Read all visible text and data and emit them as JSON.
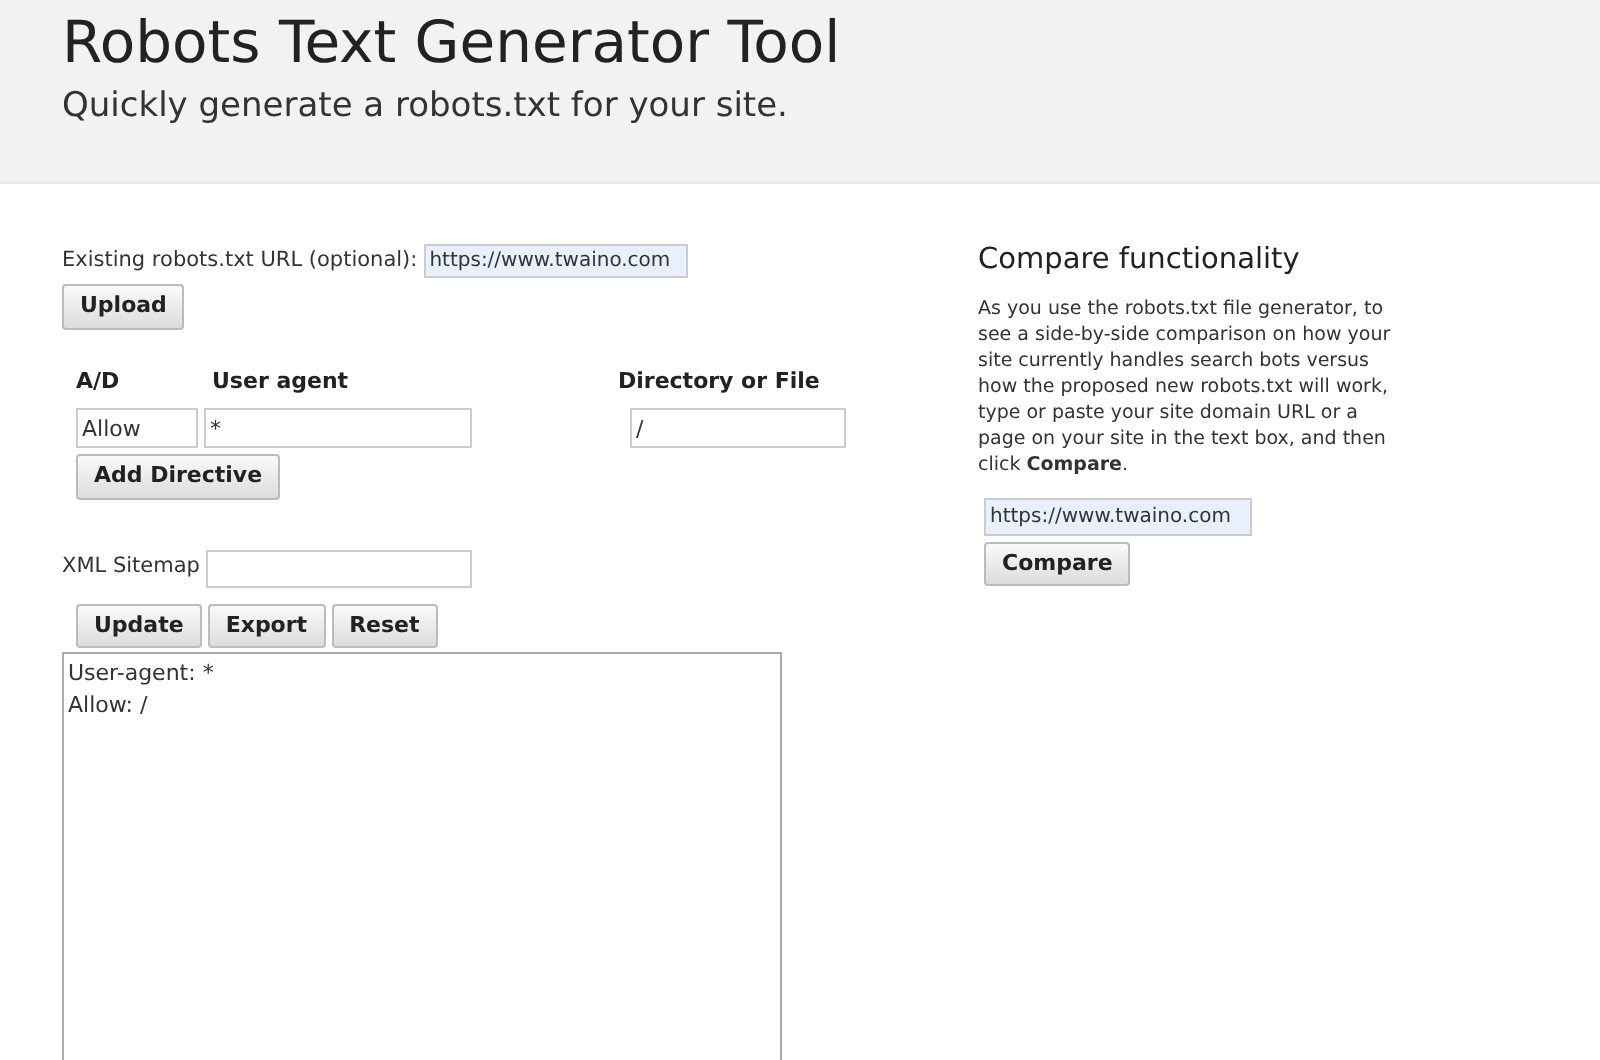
{
  "header": {
    "title": "Robots Text Generator Tool",
    "subtitle": "Quickly generate a robots.txt for your site."
  },
  "upload": {
    "label": "Existing robots.txt URL (optional):",
    "value": "https://www.twaino.com",
    "button": "Upload"
  },
  "directives": {
    "columns": [
      "A/D",
      "User agent",
      "Directory or File"
    ],
    "rows": [
      {
        "action": "Allow",
        "user_agent": "*",
        "path": "/"
      }
    ],
    "add_button": "Add Directive"
  },
  "sitemap": {
    "label": "XML Sitemap"
  },
  "actions": [
    "Update",
    "Export",
    "Reset"
  ],
  "output": "User-agent: *\nAllow: /",
  "compare": {
    "title": "Compare functionality",
    "description": "As you use the robots.txt file generator, to see a side-by-side comparison on how your site currently handles search bots versus how the proposed new robots.txt will work, type or paste your site domain URL or a page on your site in the text box, and then click **Compare**.",
    "value": "https://www.twaino.com",
    "button": "Compare"
  }
}
